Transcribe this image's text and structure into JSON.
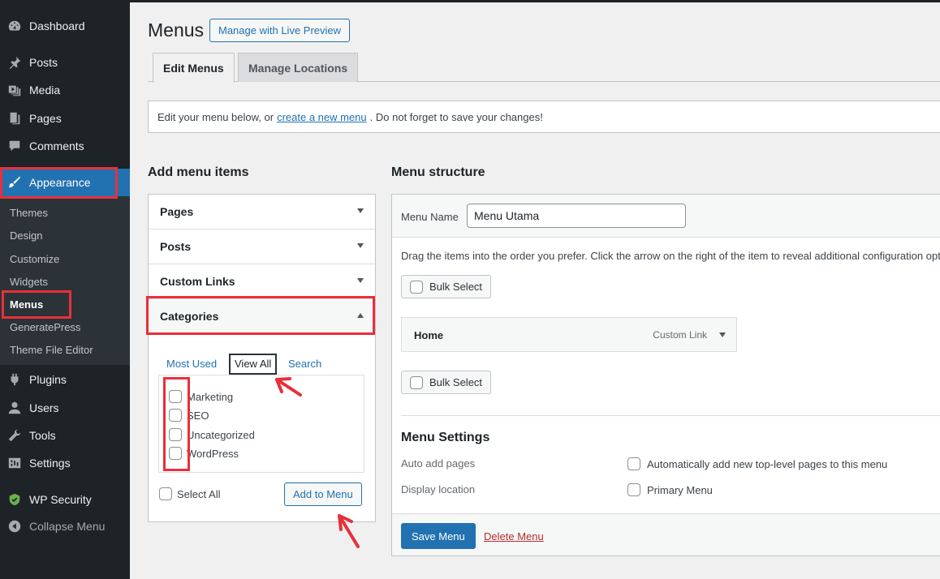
{
  "sidebar": {
    "items": [
      {
        "label": "Dashboard",
        "icon": "dashboard-icon"
      },
      {
        "label": "Posts",
        "icon": "pin-icon"
      },
      {
        "label": "Media",
        "icon": "media-icon"
      },
      {
        "label": "Pages",
        "icon": "pages-icon"
      },
      {
        "label": "Comments",
        "icon": "comment-icon"
      },
      {
        "label": "Appearance",
        "icon": "brush-icon"
      },
      {
        "label": "Plugins",
        "icon": "plugin-icon"
      },
      {
        "label": "Users",
        "icon": "user-icon"
      },
      {
        "label": "Tools",
        "icon": "wrench-icon"
      },
      {
        "label": "Settings",
        "icon": "settings-icon"
      },
      {
        "label": "WP Security",
        "icon": "shield-icon"
      },
      {
        "label": "Collapse Menu",
        "icon": "collapse-icon"
      }
    ],
    "submenu": [
      "Themes",
      "Design",
      "Customize",
      "Widgets",
      "Menus",
      "GeneratePress",
      "Theme File Editor"
    ]
  },
  "header": {
    "title": "Menus",
    "live_preview": "Manage with Live Preview"
  },
  "tabs": [
    "Edit Menus",
    "Manage Locations"
  ],
  "notice": {
    "before": "Edit your menu below, or",
    "link": "create a new menu",
    "after": ". Do not forget to save your changes!"
  },
  "add_items": {
    "title": "Add menu items",
    "sections": [
      "Pages",
      "Posts",
      "Custom Links",
      "Categories"
    ],
    "category_tabs": [
      "Most Used",
      "View All",
      "Search"
    ],
    "categories": [
      "Marketing",
      "SEO",
      "Uncategorized",
      "WordPress"
    ],
    "select_all": "Select All",
    "add_button": "Add to Menu"
  },
  "structure": {
    "title": "Menu structure",
    "menu_name_label": "Menu Name",
    "menu_name_value": "Menu Utama",
    "hint": "Drag the items into the order you prefer. Click the arrow on the right of the item to reveal additional configuration options.",
    "bulk_select": "Bulk Select",
    "items": [
      {
        "title": "Home",
        "type": "Custom Link"
      }
    ],
    "settings_title": "Menu Settings",
    "auto_add_label": "Auto add pages",
    "auto_add_option": "Automatically add new top-level pages to this menu",
    "display_label": "Display location",
    "display_option": "Primary Menu",
    "save": "Save Menu",
    "delete": "Delete Menu"
  },
  "colors": {
    "sidebar": "#1d2327",
    "accent": "#2271b1",
    "annotation": "#e8303a",
    "delete": "#b32d2e"
  }
}
